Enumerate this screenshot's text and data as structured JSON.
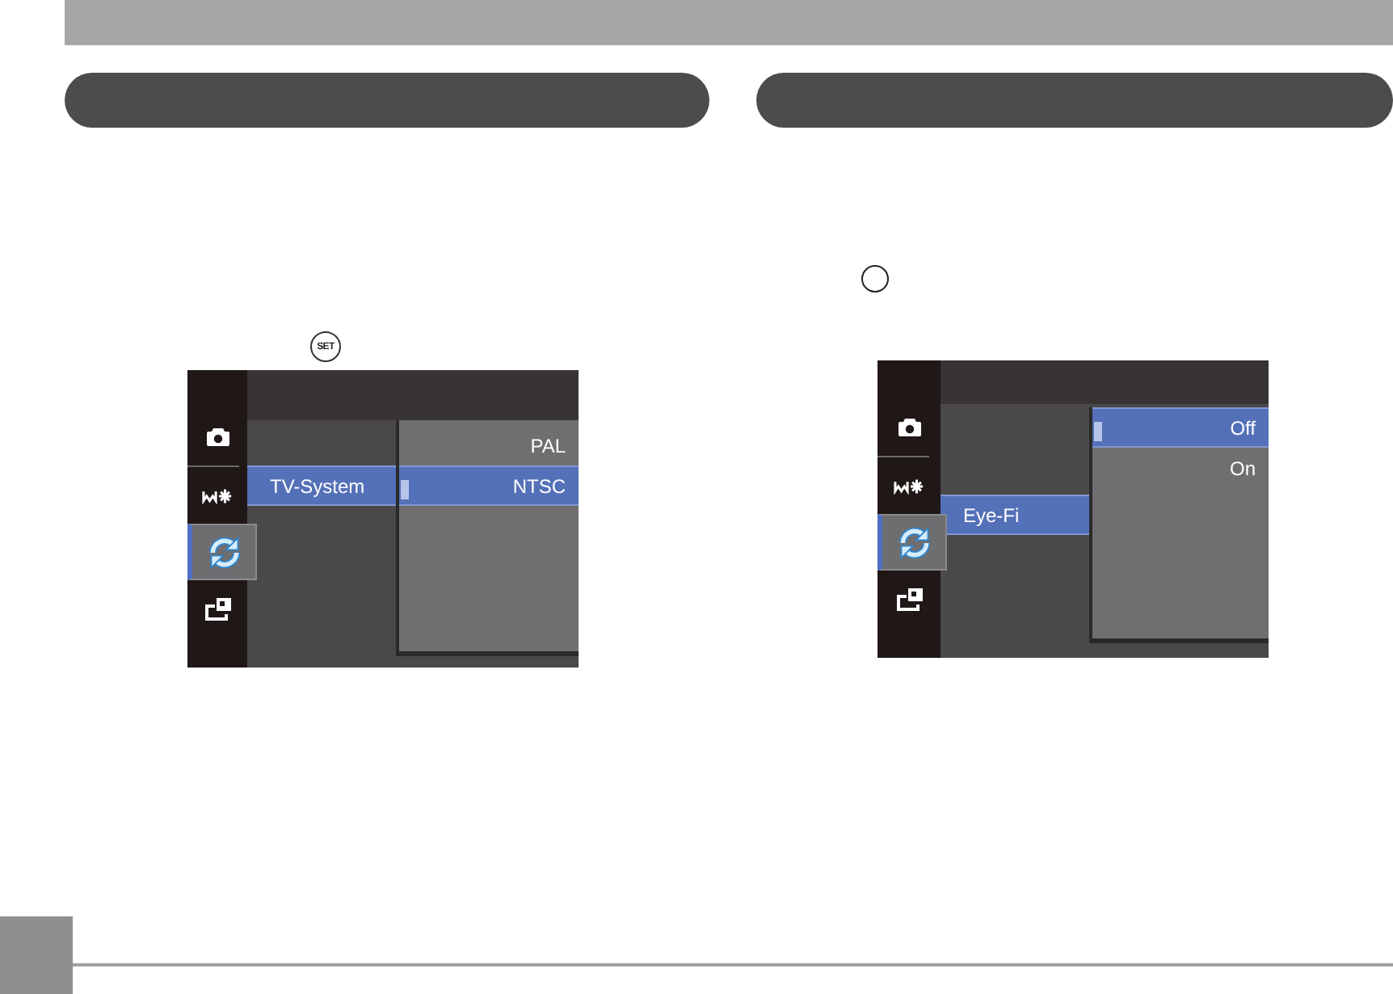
{
  "sections": [
    {
      "key_symbol": {
        "kind": "set",
        "label": "SET"
      },
      "screen": {
        "tabs": [
          {
            "kind": "camera",
            "selected": false
          },
          {
            "kind": "effects",
            "selected": false
          },
          {
            "kind": "refresh",
            "selected": true
          },
          {
            "kind": "frame",
            "selected": false
          }
        ],
        "menu_items": [
          {
            "label": "TV-System",
            "selected": true
          }
        ],
        "options": [
          {
            "label": "PAL",
            "selected": false
          },
          {
            "label": "NTSC",
            "selected": true
          }
        ]
      }
    },
    {
      "key_symbol": {
        "kind": "circle"
      },
      "screen": {
        "tabs": [
          {
            "kind": "camera",
            "selected": false
          },
          {
            "kind": "effects",
            "selected": false
          },
          {
            "kind": "refresh",
            "selected": true
          },
          {
            "kind": "frame",
            "selected": false
          }
        ],
        "menu_items": [
          {
            "label": "Eye-Fi",
            "selected": true
          }
        ],
        "options": [
          {
            "label": "Off",
            "selected": true
          },
          {
            "label": "On",
            "selected": false
          }
        ]
      }
    }
  ]
}
